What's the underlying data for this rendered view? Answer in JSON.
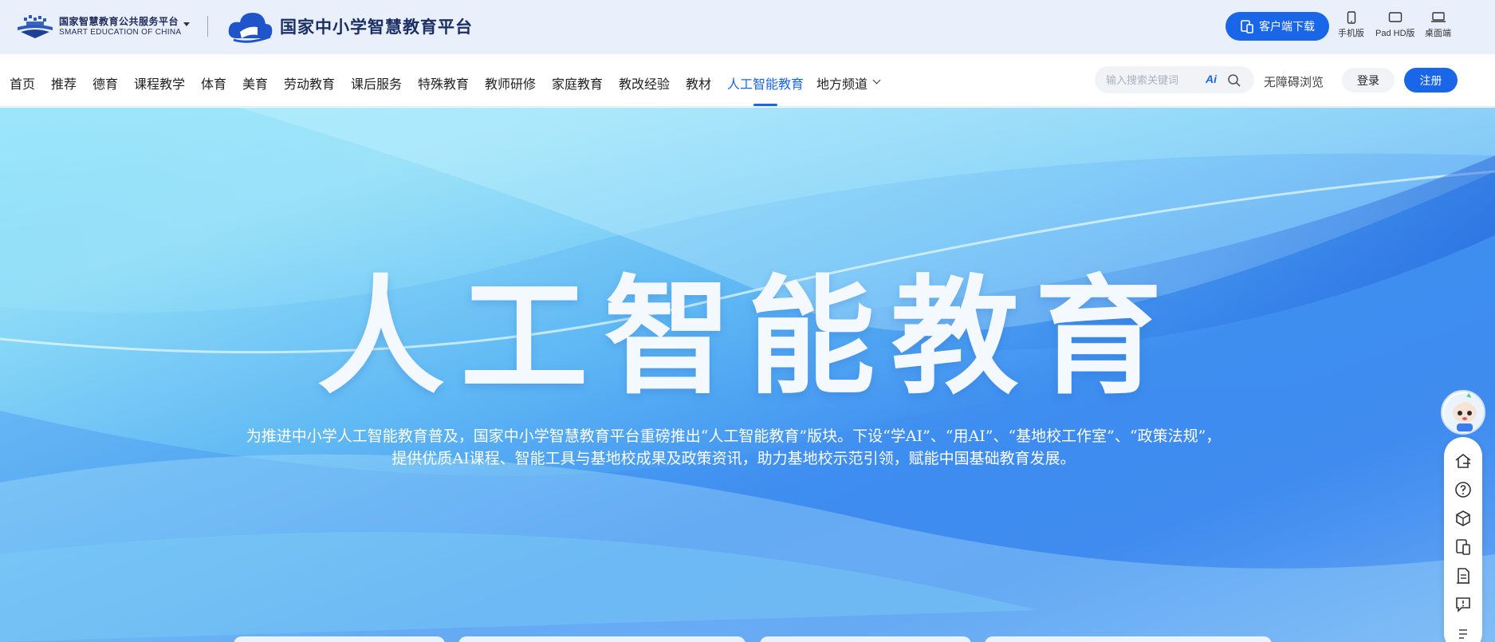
{
  "header": {
    "brand_cn": "国家智慧教育公共服务平台",
    "brand_en": "SMART EDUCATION OF CHINA",
    "platform_title": "国家中小学智慧教育平台",
    "download_label": "客户端下载",
    "devices": [
      {
        "label": "手机版",
        "icon": "phone-icon"
      },
      {
        "label": "Pad HD版",
        "icon": "tablet-icon"
      },
      {
        "label": "桌面端",
        "icon": "desktop-icon"
      }
    ]
  },
  "nav": {
    "items": [
      "首页",
      "推荐",
      "德育",
      "课程教学",
      "体育",
      "美育",
      "劳动教育",
      "课后服务",
      "特殊教育",
      "教师研修",
      "家庭教育",
      "教改经验",
      "教材",
      "人工智能教育",
      "地方频道"
    ],
    "active": "人工智能教育",
    "search_placeholder": "输入搜索关键词",
    "ai_label": "Ai",
    "accessibility": "无障碍浏览",
    "login": "登录",
    "register": "注册"
  },
  "hero": {
    "title": "人工智能教育",
    "description": "为推进中小学人工智能教育普及，国家中小学智慧教育平台重磅推出“人工智能教育”版块。下设“学AI”、“用AI”、“基地校工作室”、“政策法规”，提供优质AI课程、智能工具与基地校成果及政策资讯，助力基地校示范引领，赋能中国基础教育发展。"
  },
  "side_bar": {
    "icons": [
      "home-icon",
      "help-icon",
      "cube-icon",
      "devices-icon",
      "document-icon",
      "feedback-icon",
      "menu-icon"
    ]
  },
  "colors": {
    "accent": "#1a66e8",
    "topbar_bg": "#e9f0fb",
    "brand_text": "#1b2f66"
  }
}
